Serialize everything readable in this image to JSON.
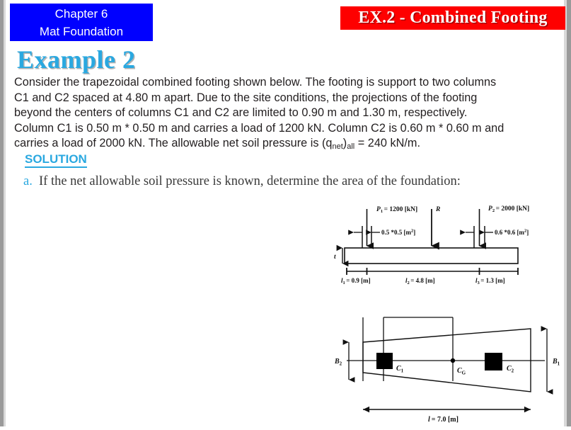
{
  "header": {
    "chapter_line1": "Chapter 6",
    "chapter_line2": "Mat Foundation",
    "chapter_bg": "#0000FF",
    "exercise_title": "EX.2 - Combined Footing",
    "exercise_bg": "#FE0000"
  },
  "slide": {
    "title": "Example 2",
    "title_color": "#2AA8E0",
    "paragraph_line1": "Consider the trapezoidal combined footing shown below. The footing is support to two columns",
    "paragraph_line2": "C1 and C2 spaced at 4.80 m apart. Due to the site conditions, the projections of the footing",
    "paragraph_line3": "beyond the centers of columns C1 and C2 are limited to 0.90 m and 1.30 m, respectively.",
    "paragraph_line4": "Column C1 is 0.50 m * 0.50 m and carries a load of 1200 kN. Column C2 is 0.60 m * 0.60 m and",
    "paragraph_line5_pre": "carries a load of 2000 kN. The allowable net soil pressure is (q",
    "paragraph_line5_sub1": "net",
    "paragraph_line5_mid": ")",
    "paragraph_line5_sub2": "all",
    "paragraph_line5_post": " = 240 kN/m.",
    "solution_heading": "SOLUTION",
    "solution_item_marker": "a.",
    "solution_item_text": "If the net allowable soil pressure is known, determine the area of the foundation:"
  },
  "figure_elevation": {
    "label_P1": "P",
    "label_P1_sub": "1",
    "label_P1_value": "= 1200 [kN]",
    "label_R": "R",
    "label_P2": "P",
    "label_P2_sub": "2",
    "label_P2_value": "= 2000 [kN]",
    "col1_size": "0.5 *0.5 [m",
    "col1_size_sup": "2",
    "col1_size_end": "]",
    "col2_size": "0.6 *0.6 [m",
    "col2_size_sup": "2",
    "col2_size_end": "]",
    "thickness_label": "t",
    "dim_l1": "l",
    "dim_l1_sub": "1",
    "dim_l1_value": "= 0.9 [m]",
    "dim_l2": "l",
    "dim_l2_sub": "2",
    "dim_l2_value": "= 4.8 [m]",
    "dim_l3": "l",
    "dim_l3_sub": "3",
    "dim_l3_value": "= 1.3 [m]"
  },
  "figure_plan": {
    "label_B2": "B",
    "label_B2_sub": "2",
    "label_B1": "B",
    "label_B1_sub": "1",
    "label_C1": "C",
    "label_C1_sub": "1",
    "label_CG": "C",
    "label_CG_sub": "G",
    "label_C2": "C",
    "label_C2_sub": "2",
    "dim_L": "l",
    "dim_L_value": "= 7.0 [m]"
  }
}
